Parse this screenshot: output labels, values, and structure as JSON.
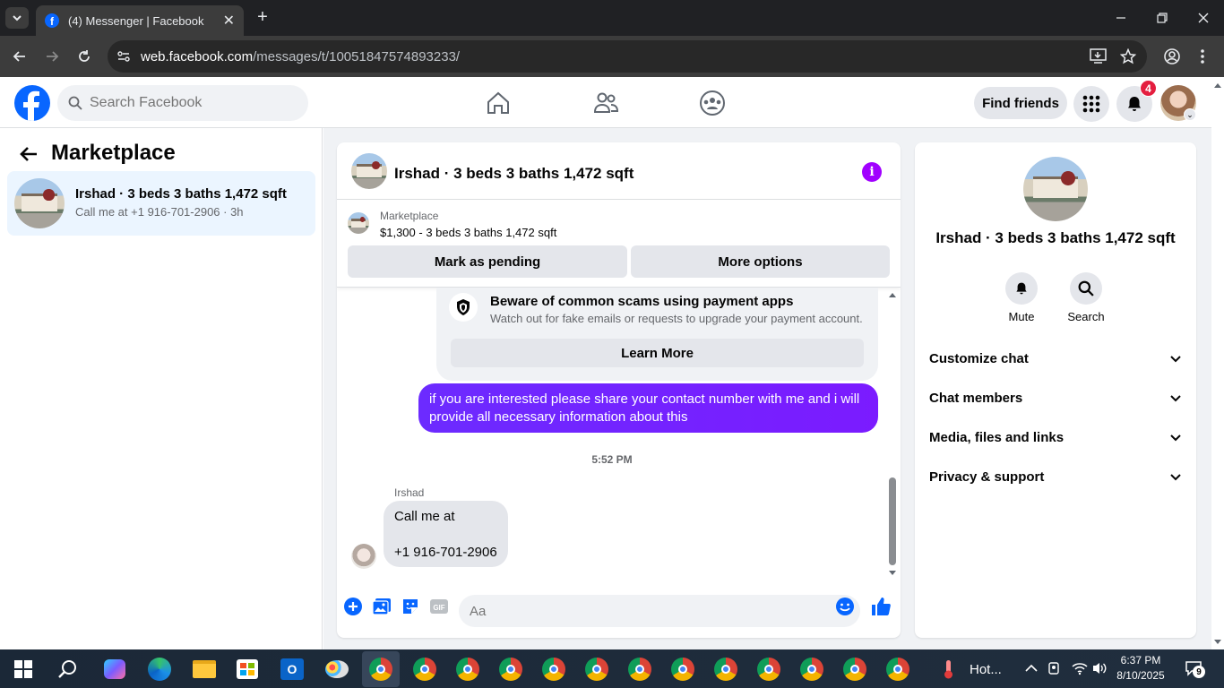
{
  "browser": {
    "tab_title": "(4) Messenger | Facebook",
    "url_domain": "web.facebook.com",
    "url_path": "/messages/t/10051847574893233/"
  },
  "fb_header": {
    "search_placeholder": "Search Facebook",
    "find_friends": "Find friends",
    "notification_count": "4"
  },
  "left_panel": {
    "title": "Marketplace",
    "conversation": {
      "name": "Irshad · 3 beds 3 baths 1,472 sqft",
      "snippet": "Call me at +1 916-701-2906 · 3h"
    }
  },
  "chat": {
    "header_name": "Irshad · 3 beds 3 baths 1,472 sqft",
    "marketplace_label": "Marketplace",
    "listing": "$1,300 - 3 beds 3 baths 1,472 sqft",
    "mark_pending": "Mark as pending",
    "more_options": "More options",
    "scam_title": "Beware of common scams using payment apps",
    "scam_desc": "Watch out for fake emails or requests to upgrade your payment account.",
    "learn_more": "Learn More",
    "outgoing": "if you are interested please share your contact number with me and i will provide all necessary information about this",
    "timestamp": "5:52 PM",
    "sender": "Irshad",
    "incoming_line1": "Call me at",
    "incoming_line2": "+1 916-701-2906",
    "input_placeholder": "Aa"
  },
  "right_panel": {
    "name": "Irshad · 3 beds 3 baths 1,472 sqft",
    "mute": "Mute",
    "search": "Search",
    "sections": [
      "Customize chat",
      "Chat members",
      "Media, files and links",
      "Privacy & support"
    ]
  },
  "taskbar": {
    "weather": "Hot...",
    "time": "6:37 PM",
    "date": "8/10/2025",
    "notif_count": "9"
  },
  "colors": {
    "fb_blue": "#0866ff",
    "messenger_purple": "#7b1bff",
    "info_purple": "#a100ff",
    "badge_red": "#e41e3f"
  }
}
